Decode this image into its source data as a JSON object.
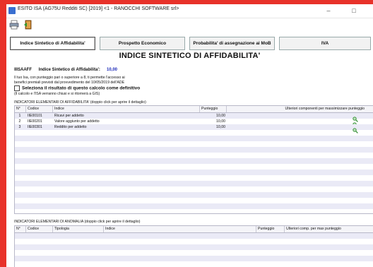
{
  "window": {
    "title": "ESITO ISA (AG75U Redditi SC) [2019] <1 - RANOCCHI SOFTWARE srl>",
    "minimize": "–",
    "maximize": "□"
  },
  "toolbar": {
    "print_icon": "printer-icon",
    "exit_icon": "exit-door-icon"
  },
  "tabs": [
    {
      "label": "Indice Sintetico di Affidabilita'",
      "active": true
    },
    {
      "label": "Prospetto Economico",
      "active": false
    },
    {
      "label": "Probabilita' di assegnazione ai MoB",
      "active": false
    },
    {
      "label": "IVA",
      "active": false
    }
  ],
  "main": {
    "title": "INDICE SINTETICO DI AFFIDABILITA'",
    "code": "IIISAAFF",
    "index_label": "Indice Sintetico di Affidabilita':",
    "index_value": "10,00",
    "info_line1": "Il tuo Isa, con punteggio pari o superiore a 8, ti permette l'accesso ai",
    "info_line2": "benefici premiali previsti dal provvedimento del 10/05/2019 dell'ADE",
    "checkbox_label": "Seleziona il risultato di questo calcolo come definitivo",
    "checkbox_note": "(Il calcolo e l'ISA verranno chiusi e si ritornerà a GIS)"
  },
  "affidabilita": {
    "label": "INDICATORI ELEMENTARI DI AFFIDABILITA' (doppio click per aprire il dettaglio)",
    "columns": [
      "N°",
      "Codice",
      "Indice",
      "Punteggio",
      "Ulteriori componenti per massimizzare punteggio"
    ],
    "rows": [
      {
        "n": "1",
        "codice": "IIE00101",
        "indice": "Ricavi per addetto",
        "punteggio": "10,00"
      },
      {
        "n": "2",
        "codice": "IIE00201",
        "indice": "Valore aggiunto per addetto",
        "punteggio": "10,00"
      },
      {
        "n": "3",
        "codice": "IIE00301",
        "indice": "Reddito per addetto",
        "punteggio": "10,00"
      }
    ]
  },
  "anomalia": {
    "label": "INDICATORI ELEMENTARI DI ANOMALIA (doppio click per aprire il dettaglio)",
    "columns": [
      "N°",
      "Codice",
      "Tipologia",
      "Indice",
      "Punteggio",
      "Ulteriori comp. per max punteggio"
    ]
  },
  "colors": {
    "accent_value": "#1a28b8",
    "alt_row": "#eaeaf6",
    "background": "#e8322a"
  }
}
